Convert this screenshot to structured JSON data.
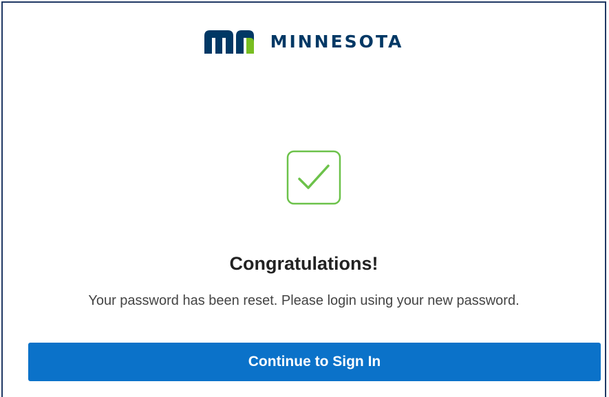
{
  "header": {
    "logo_text": "MINNESOTA",
    "logo_icon": "mn-logo-icon",
    "brand_color": "#003865",
    "brand_accent": "#78be21"
  },
  "status": {
    "icon": "checkmark-icon",
    "icon_color": "#6cc24a",
    "title": "Congratulations!",
    "message": "Your password has been reset. Please login using your new password."
  },
  "actions": {
    "continue_label": "Continue to Sign In",
    "button_color": "#0b72c9"
  }
}
